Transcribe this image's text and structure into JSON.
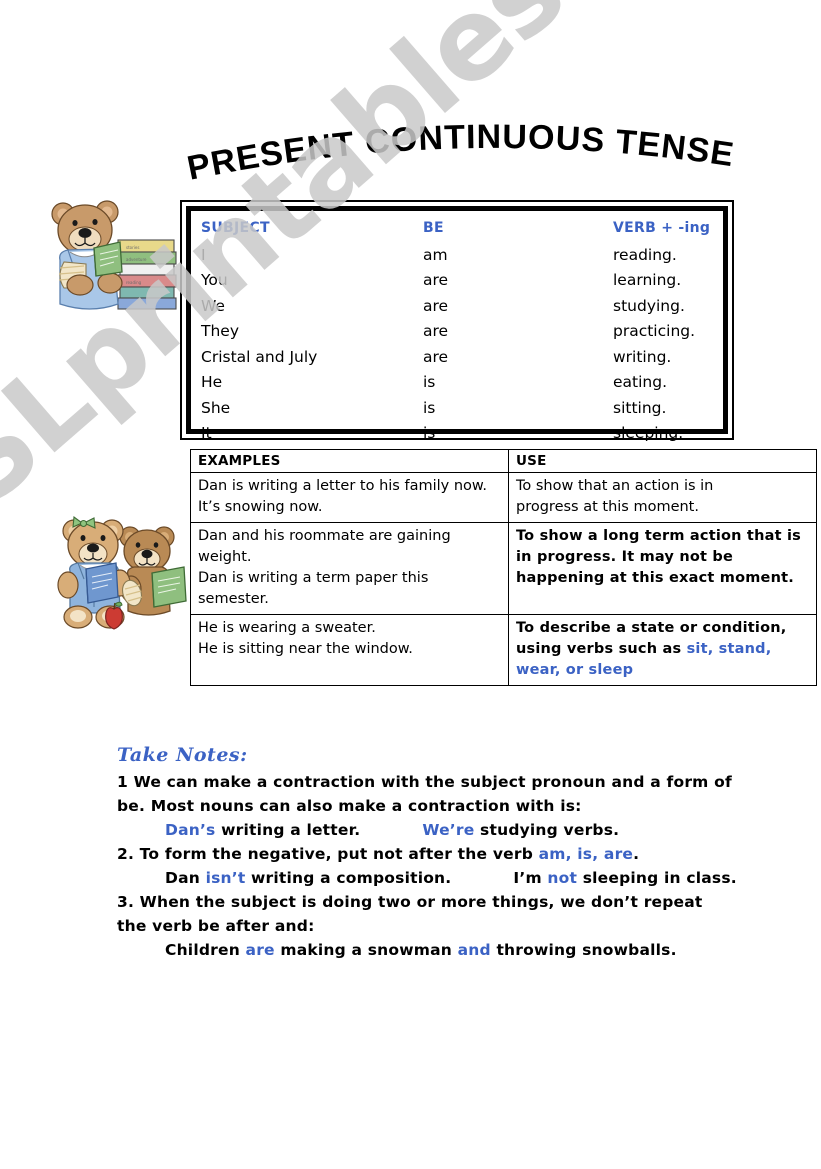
{
  "page": {
    "title": "PRESENT CONTINUOUS TENSE",
    "watermark": "ESLprintables.com",
    "accent_color": "#3b62c4",
    "text_color": "#000000",
    "background_color": "#ffffff"
  },
  "clipart": {
    "bear_reading": {
      "name": "teddy-bear-reading-with-book-stack",
      "description": "Tan teddy bear in blue overalls reading a green book beside a stack of colorful books",
      "colors": {
        "fur": "#c89a6a",
        "fur_light": "#e3c49b",
        "overalls": "#a9c7e8",
        "book_green": "#8fbf7f",
        "book_yellow": "#e8d98a",
        "book_red": "#d98a8a",
        "book_blue": "#8aa8d9",
        "book_teal": "#7fb8b0",
        "muzzle": "#f0ddbf",
        "nose": "#1a1a1a"
      }
    },
    "bears_pair": {
      "name": "two-teddy-bears-with-books-and-apple",
      "description": "Two teddy bears, the left one wearing a green bow and blue overalls holding a blue book, the right one holding a green book, with a red apple in front",
      "colors": {
        "fur": "#d8ad78",
        "fur_dark": "#b98a55",
        "overalls": "#8fb4dd",
        "bow": "#8fc47f",
        "book_blue": "#6f97cf",
        "book_green": "#8fbf7f",
        "apple": "#cc3b33",
        "muzzle": "#f3e3c6",
        "nose": "#1a1a1a"
      }
    }
  },
  "conjugation_table": {
    "headers": [
      "SUBJECT",
      "BE",
      "VERB + -ing"
    ],
    "rows": [
      {
        "subject": "I",
        "be": "am",
        "verb": "reading."
      },
      {
        "subject": "You",
        "be": "are",
        "verb": "learning."
      },
      {
        "subject": "We",
        "be": "are",
        "verb": "studying."
      },
      {
        "subject": "They",
        "be": "are",
        "verb": "practicing."
      },
      {
        "subject": "Cristal and July",
        "be": "are",
        "verb": "writing."
      },
      {
        "subject": "He",
        "be": "is",
        "verb": "eating."
      },
      {
        "subject": "She",
        "be": "is",
        "verb": "sitting."
      },
      {
        "subject": "It",
        "be": "is",
        "verb": "sleeping."
      }
    ]
  },
  "examples_table": {
    "headers": [
      "EXAMPLES",
      "USE"
    ],
    "rows": [
      {
        "examples": [
          "Dan is writing a letter to his family now.",
          "It’s snowing now."
        ],
        "use_lines": [
          "To show that an action is in",
          "progress at this moment."
        ],
        "use_bold": false
      },
      {
        "examples": [
          "Dan and his roommate are gaining weight.",
          "Dan is writing a term paper this semester."
        ],
        "use_lines": [
          "To show a long term action that is",
          "in progress. It may not be",
          "happening at this exact moment."
        ],
        "use_bold": true
      },
      {
        "examples": [
          "He is wearing a sweater.",
          "He is sitting near the window."
        ],
        "use_prefix": "To describe a state or condition, using verbs such as ",
        "use_highlight": "sit, stand, wear, or sleep",
        "use_bold": true
      }
    ]
  },
  "notes": {
    "heading": "Take Notes:",
    "items": [
      {
        "number": "1",
        "text": "1 We can make a contraction with the subject pronoun and a form of be. Most nouns can also make a contraction with is:",
        "examples": [
          {
            "highlight": "Dan’s",
            "rest": " writing a letter."
          },
          {
            "highlight": "We’re",
            "rest": " studying verbs."
          }
        ]
      },
      {
        "number": "2",
        "text_before": "2. To form the negative, put not after the verb ",
        "highlight": "am, is, are",
        "text_after": ".",
        "examples": [
          {
            "before": "Dan ",
            "highlight": "isn’t",
            "rest": " writing a composition."
          },
          {
            "before": "I’m ",
            "highlight": "not",
            "rest": " sleeping in class."
          }
        ]
      },
      {
        "number": "3",
        "text": "3. When the subject is doing two or more things, we don’t repeat the verb be after and:",
        "example_parts": [
          {
            "plain": "Children "
          },
          {
            "highlight": "are"
          },
          {
            "plain": " making a snowman "
          },
          {
            "highlight": "and"
          },
          {
            "plain": " throwing snowballs."
          }
        ]
      }
    ]
  }
}
